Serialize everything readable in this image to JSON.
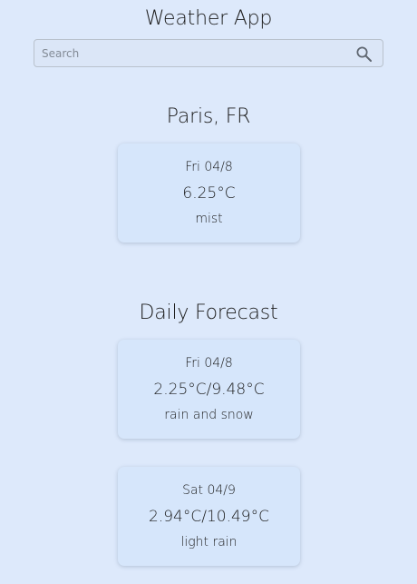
{
  "app": {
    "title": "Weather App"
  },
  "search": {
    "placeholder": "Search",
    "value": "",
    "icon": "search-icon"
  },
  "current": {
    "city": "Paris, FR",
    "date": "Fri 04/8",
    "temp": "6.25°C",
    "description": "mist"
  },
  "forecast": {
    "title": "Daily Forecast",
    "days": [
      {
        "date": "Fri 04/8",
        "temp": "2.25°C/9.48°C",
        "description": "rain and snow"
      },
      {
        "date": "Sat 04/9",
        "temp": "2.94°C/10.49°C",
        "description": "light rain"
      }
    ]
  },
  "colors": {
    "background": "#dde9fb",
    "card": "#d6e6fb",
    "text": "#1b1b1b",
    "placeholder": "#838b96"
  }
}
